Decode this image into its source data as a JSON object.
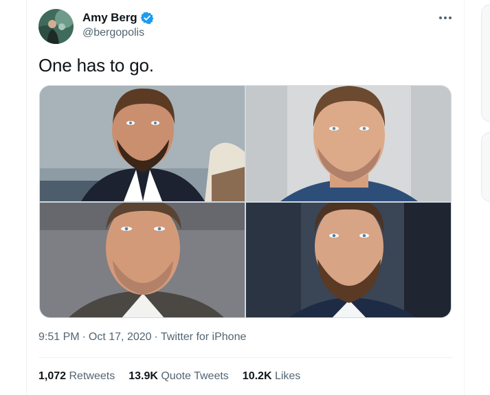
{
  "author": {
    "name": "Amy Berg",
    "handle": "@bergopolis",
    "verified": true
  },
  "tweet": {
    "text": "One has to go."
  },
  "media": {
    "images": [
      {
        "alt": "",
        "icon": "photo-1"
      },
      {
        "alt": "",
        "icon": "photo-2"
      },
      {
        "alt": "",
        "icon": "photo-3"
      },
      {
        "alt": "",
        "icon": "photo-4"
      }
    ]
  },
  "meta": {
    "time": "9:51 PM",
    "sep1": "·",
    "date": "Oct 17, 2020",
    "sep2": "·",
    "source": "Twitter for iPhone"
  },
  "stats": {
    "retweets_count": "1,072",
    "retweets_label": "Retweets",
    "quotes_count": "13.9K",
    "quotes_label": "Quote Tweets",
    "likes_count": "10.2K",
    "likes_label": "Likes"
  },
  "colors": {
    "text": "#0f1419",
    "secondary": "#536471",
    "verified": "#1d9bf0",
    "border": "#eff3f4"
  }
}
